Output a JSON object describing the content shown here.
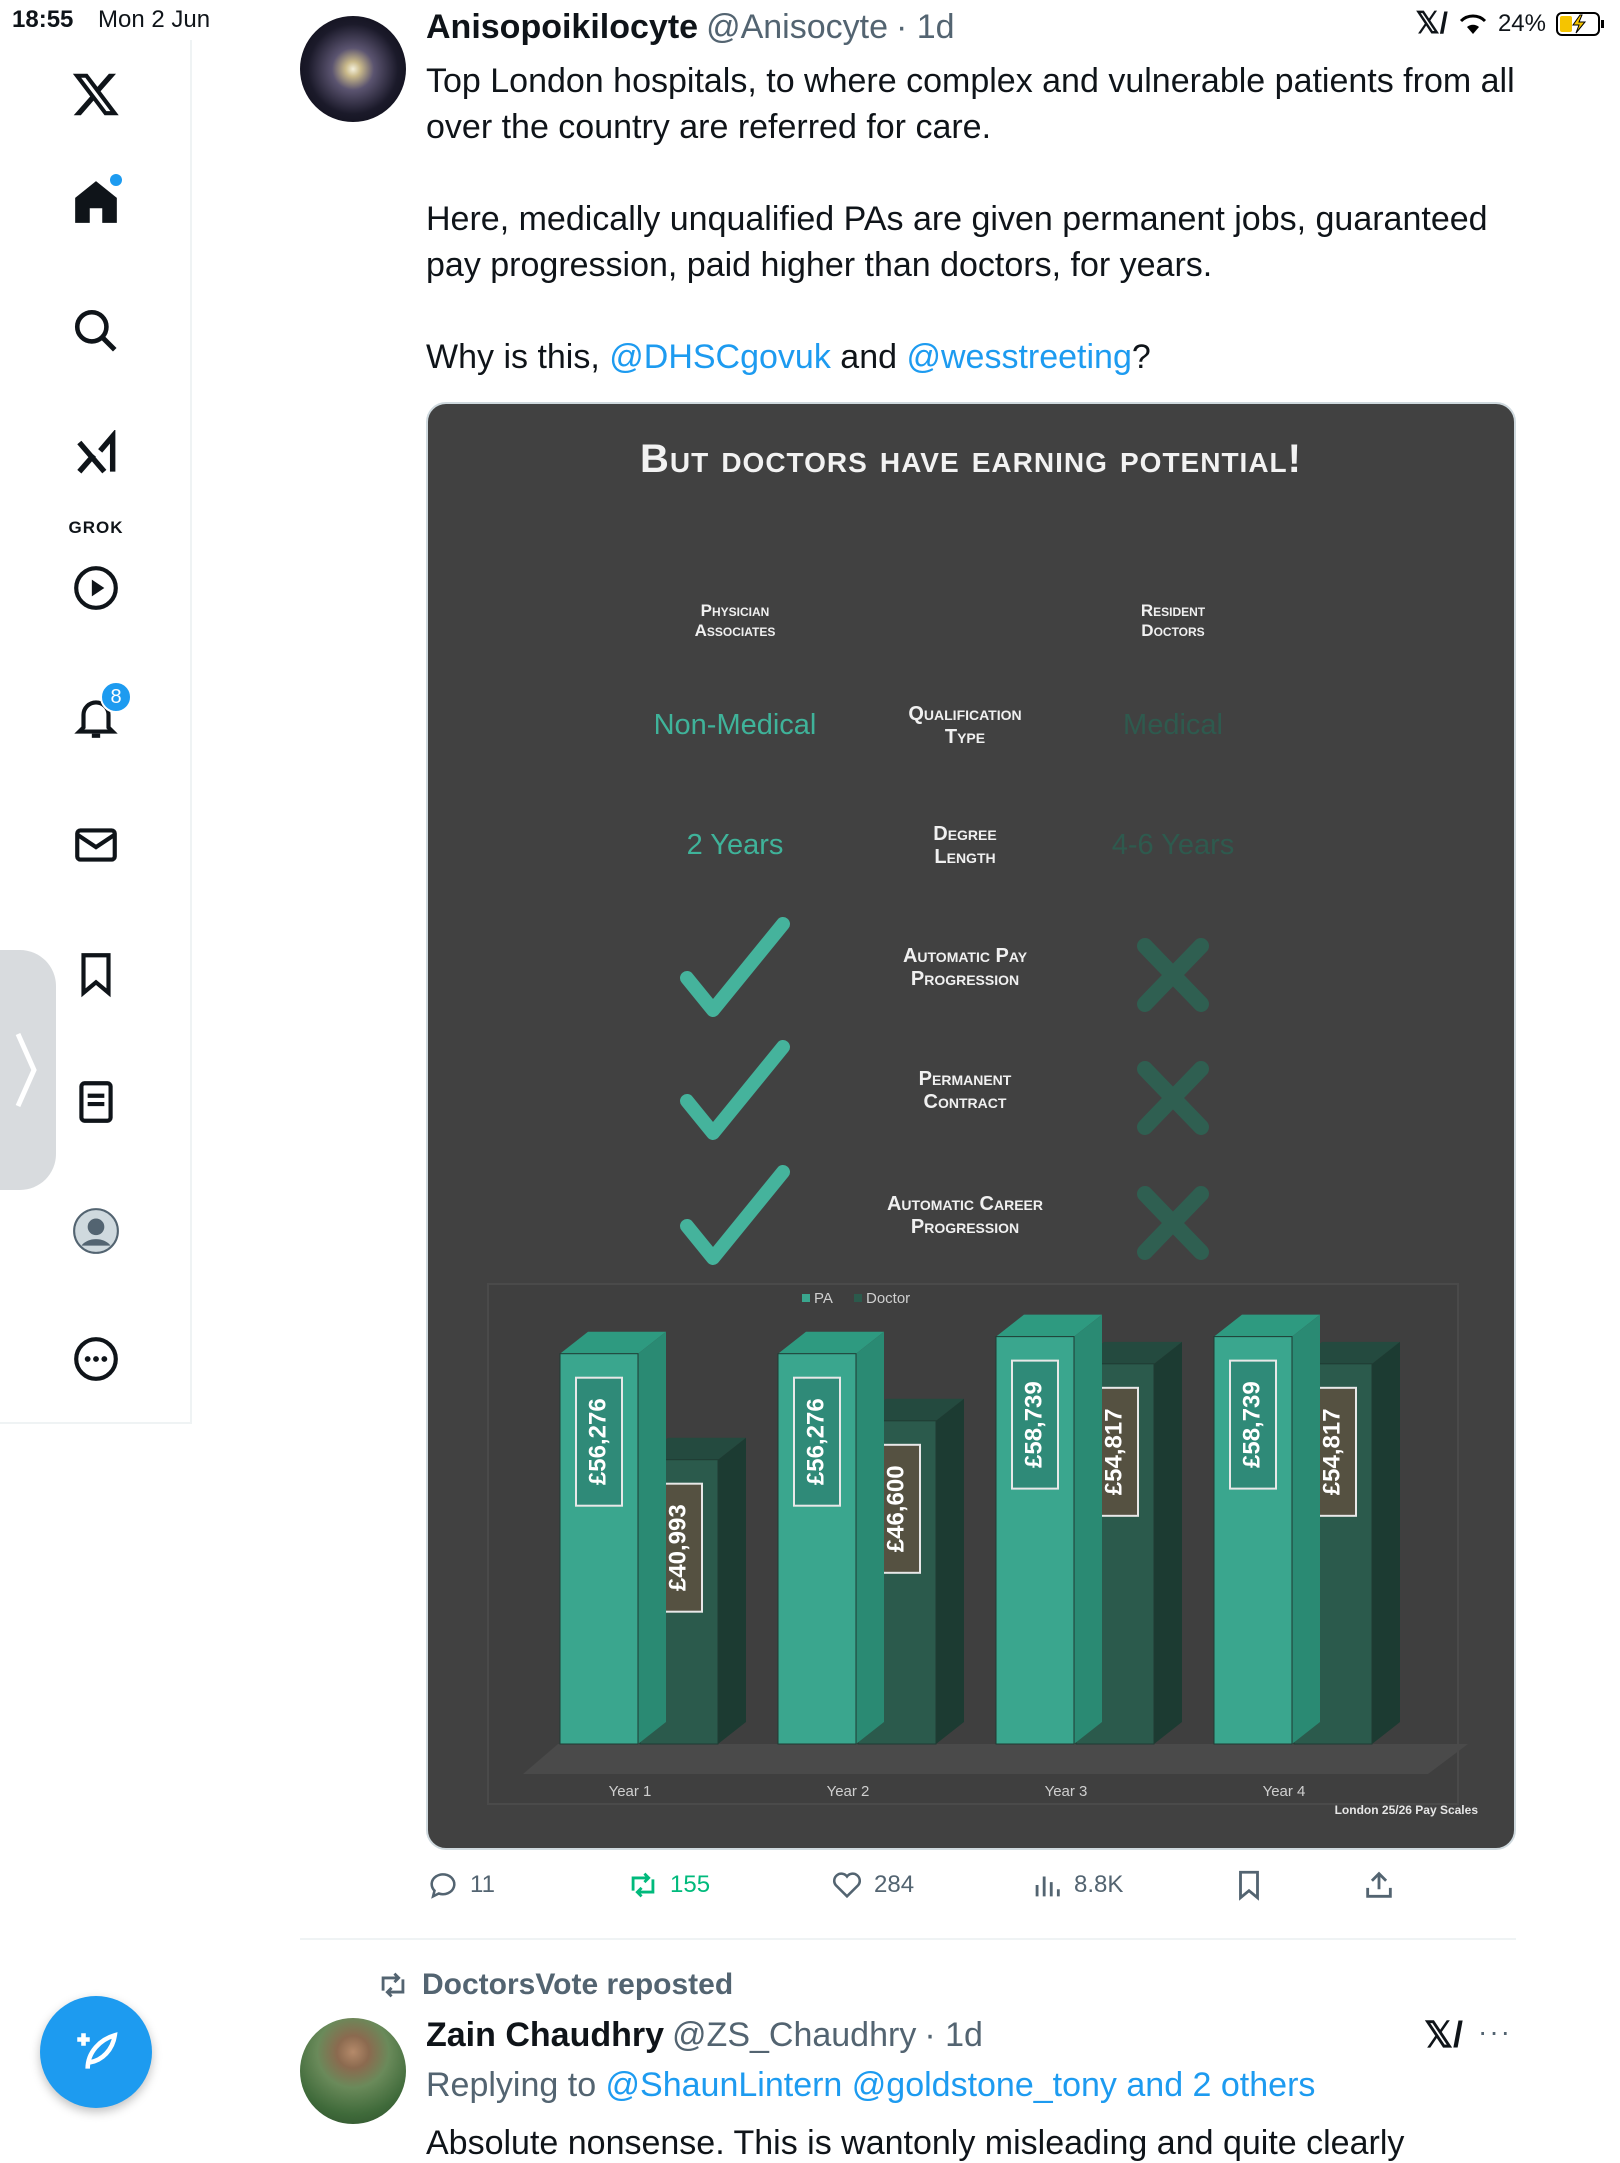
{
  "status_bar": {
    "time": "18:55",
    "date": "Mon 2 Jun",
    "battery": "24%"
  },
  "sidebar": {
    "grok_label": "GROK",
    "notifications_count": "8"
  },
  "tweet": {
    "display_name": "Anisopoikilocyte",
    "handle": "@Anisocyte",
    "time": "· 1d",
    "paragraph1": "Top London hospitals, to where complex and vulnerable patients from all over the country are referred for care.",
    "paragraph2": "Here, medically unqualified PAs are given permanent jobs, guaranteed pay progression, paid higher than doctors, for years.",
    "p3_prefix": "Why is this, ",
    "mention1": "@DHSCgovuk",
    "p3_and": " and ",
    "mention2": "@wesstreeting",
    "p3_suffix": "?",
    "actions": {
      "replies": "11",
      "reposts": "155",
      "likes": "284",
      "views": "8.8K"
    }
  },
  "infographic": {
    "title": "But doctors have earning potential!",
    "col_left": [
      "Physician",
      "Associates"
    ],
    "col_right": [
      "Resident",
      "Doctors"
    ],
    "rows": [
      {
        "label": [
          "Qualification",
          "Type"
        ],
        "left": "Non-Medical",
        "right": "Medical",
        "left_kind": "text",
        "right_kind": "text"
      },
      {
        "label": [
          "Degree",
          "Length"
        ],
        "left": "2 Years",
        "right": "4-6 Years",
        "left_kind": "text",
        "right_kind": "text"
      },
      {
        "label": [
          "Automatic Pay",
          "Progression"
        ],
        "left_kind": "check",
        "right_kind": "cross"
      },
      {
        "label": [
          "Permanent",
          "Contract"
        ],
        "left_kind": "check",
        "right_kind": "cross"
      },
      {
        "label": [
          "Automatic Career",
          "Progression"
        ],
        "left_kind": "check",
        "right_kind": "cross"
      }
    ],
    "source_note": "London 25/26 Pay Scales"
  },
  "chart_data": {
    "type": "bar",
    "categories": [
      "Year 1",
      "Year 2",
      "Year 3",
      "Year 4"
    ],
    "series": [
      {
        "name": "PA",
        "values": [
          56276,
          56276,
          58739,
          58739
        ],
        "labels": [
          "£56,276",
          "£56,276",
          "£58,739",
          "£58,739"
        ]
      },
      {
        "name": "Doctor",
        "values": [
          40993,
          46600,
          54817,
          54817
        ],
        "labels": [
          "£40,993",
          "£46,600",
          "£54,817",
          "£54,817"
        ]
      }
    ],
    "ylim": [
      0,
      62000
    ],
    "legend_position": "top",
    "colors": {
      "pa": "#3aa68e",
      "doctor": "#2b5a4c"
    }
  },
  "repost": {
    "reposter": "DoctorsVote reposted",
    "display_name": "Zain Chaudhry",
    "handle": "@ZS_Chaudhry",
    "time": "· 1d",
    "replying_prefix": "Replying to ",
    "replying_to": "@ShaunLintern @goldstone_tony and 2 others",
    "text": "Absolute nonsense. This is wantonly misleading and quite clearly"
  },
  "colors": {
    "accent": "#1d9bf0",
    "repost_green": "#00ba7c",
    "infographic_bg": "#414141"
  }
}
